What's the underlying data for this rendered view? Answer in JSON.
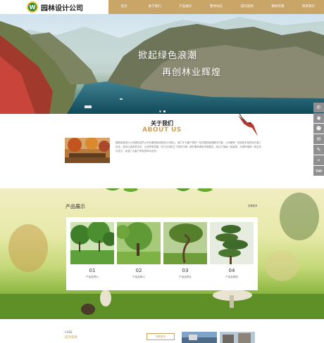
{
  "logo": {
    "text": "园林设计公司",
    "mark": "W"
  },
  "nav": [
    "首页",
    "关于我们",
    "产品展示",
    "整体动态",
    "成功案例",
    "解除有限",
    "联系我们"
  ],
  "banner": {
    "line1": "掀起绿色浪潮",
    "line2": "再创林业辉煌"
  },
  "about": {
    "title_cn": "关于我们",
    "title_en": "ABOUT US",
    "text": "园林景观设计公司团队成员以专业服务和创新设计为核心，致力于为客户提供一站式园林景观解决方案。公司拥有一支经验丰富的设计施工队伍，坚持以品质求生存、以信誉求发展，在行业内树立了良好口碑。我们秉承绿色环保理念，用心打造每一处景观，为城市增添一抹生机与活力，欢迎广大客户来电咨询与合作。"
  },
  "products": {
    "title": "产品展示",
    "more": "查看更多",
    "items": [
      {
        "num": "01",
        "name": "产品名称七"
      },
      {
        "num": "02",
        "name": "产品名称六"
      },
      {
        "num": "03",
        "name": "产品名称五"
      },
      {
        "num": "04",
        "name": "产品名称四"
      }
    ]
  },
  "case": {
    "en": "CASE",
    "cn": "成功案例",
    "button": "查看更多"
  },
  "side_icons": [
    "phone-icon",
    "qq-icon",
    "user-icon",
    "wechat-icon",
    "edit-icon",
    "search-icon",
    "back-to-top-icon"
  ],
  "side_top_label": "TOP",
  "colors": {
    "accent": "#c9a568",
    "accent_dark": "#b8924f",
    "gold_text": "#c9a05a",
    "sidebar": "#8f8f8f"
  }
}
